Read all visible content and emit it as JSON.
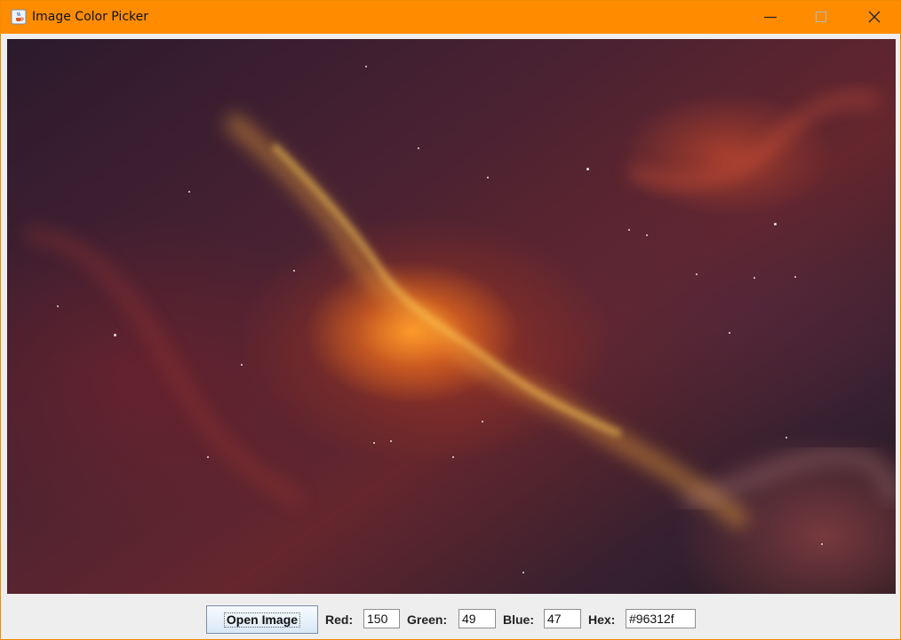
{
  "window": {
    "title": "Image Color Picker"
  },
  "controls": {
    "open_label": "Open Image",
    "red_label": "Red:",
    "red_value": "150",
    "green_label": "Green:",
    "green_value": "49",
    "blue_label": "Blue:",
    "blue_value": "47",
    "hex_label": "Hex:",
    "hex_value": "#96312f"
  },
  "icons": {
    "app": "java-coffee-icon",
    "minimize": "minimize-icon",
    "maximize": "maximize-icon",
    "close": "close-icon"
  },
  "colors": {
    "titlebar": "#ff8c00",
    "picked": "#96312f"
  }
}
